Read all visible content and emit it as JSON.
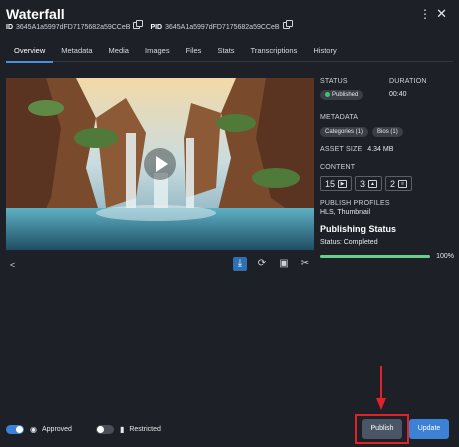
{
  "header": {
    "title": "Waterfall",
    "id_label": "ID",
    "id_value": "3645A1a5997dFD7175682a59CCeB",
    "pid_label": "PID",
    "pid_value": "3645A1a5997dFD7175682a59CCeB"
  },
  "tabs": [
    {
      "label": "Overview",
      "active": true
    },
    {
      "label": "Metadata"
    },
    {
      "label": "Media"
    },
    {
      "label": "Images"
    },
    {
      "label": "Files"
    },
    {
      "label": "Stats"
    },
    {
      "label": "Transcriptions"
    },
    {
      "label": "History"
    }
  ],
  "side": {
    "status_label": "STATUS",
    "status_value": "Published",
    "duration_label": "DURATION",
    "duration_value": "00:40",
    "metadata_label": "METADATA",
    "meta_chips": [
      "Categories (1)",
      "Bios (1)"
    ],
    "asset_size_label": "ASSET SIZE",
    "asset_size_value": "4.34 MB",
    "content_label": "CONTENT",
    "content_counts": [
      "15",
      "3",
      "2"
    ],
    "publish_profiles_label": "PUBLISH PROFILES",
    "publish_profiles_value": "HLS, Thumbnail",
    "publishing_status_title": "Publishing Status",
    "publishing_status_text": "Status: Completed",
    "progress_percent": 100,
    "progress_label": "100%"
  },
  "bottom": {
    "approved_label": "Approved",
    "approved_on": true,
    "restricted_label": "Restricted",
    "restricted_on": false,
    "publish_label": "Publish",
    "update_label": "Update"
  },
  "colors": {
    "accent": "#3b82d6",
    "success": "#3cc36b",
    "highlight": "#e0232b"
  }
}
